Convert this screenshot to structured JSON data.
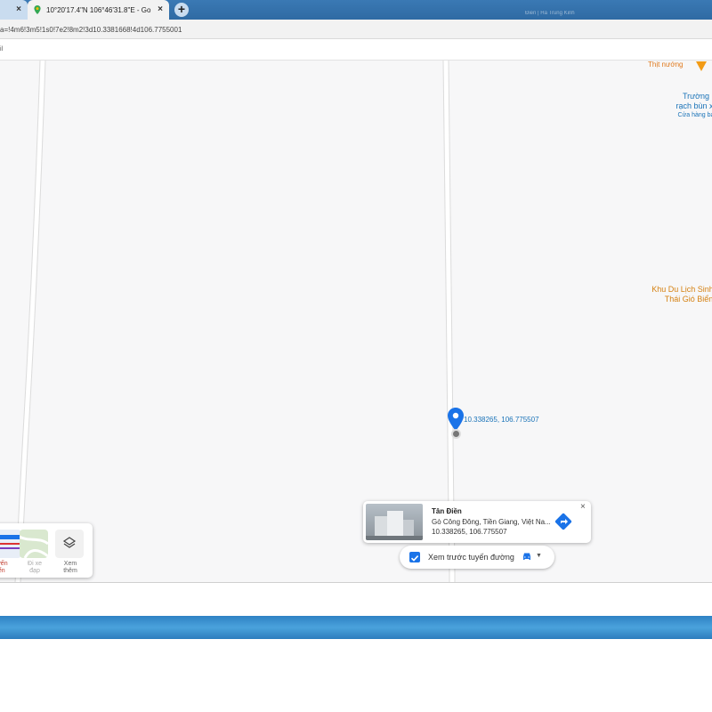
{
  "browser": {
    "tabs": [
      {
        "label": "",
        "close": "×"
      },
      {
        "label": "10°20'17.4\"N 106°46'31.8\"E - Go",
        "close": "×"
      }
    ],
    "new_tab": "+",
    "url": "a=!4m6!3m5!1s0!7e2!8m2!3d10.3381668!4d106.7755001",
    "bookmark_fragment": "il",
    "taskbar_search": "Điền | Hà Trung Kinh"
  },
  "map": {
    "pois": {
      "grill": "Thịt nướng",
      "truong": "Trường",
      "rach": "rạch bùn xả",
      "store": "Cửa hàng bá",
      "khu1": "Khu Du Lịch Sinh",
      "khu2": "Thái Gió Biển"
    },
    "pin_label": "10.338265, 106.775507",
    "accent": "#1a73e8"
  },
  "info_card": {
    "title": "Tân Điền",
    "address": "Gò Công Đông, Tiền Giang, Việt Na...",
    "coords": "10.338265, 106.775507",
    "close": "×"
  },
  "preview": {
    "label": "Xem trước tuyến đường",
    "checked": true
  },
  "layers": {
    "transit": "uyến\niển",
    "bike": "Đi xe\nđạp",
    "more": "Xem\nthêm"
  }
}
